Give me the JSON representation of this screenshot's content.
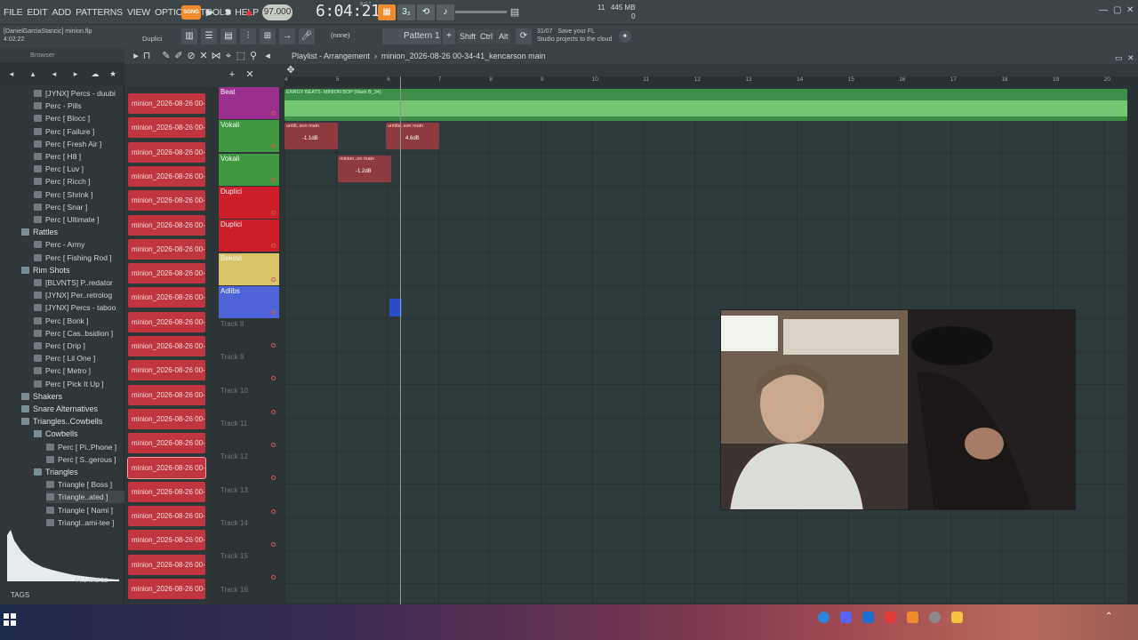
{
  "menu": [
    "FILE",
    "EDIT",
    "ADD",
    "PATTERNS",
    "VIEW",
    "OPTIONS",
    "TOOLS",
    "HELP"
  ],
  "transport": {
    "song_label": "SONG",
    "tempo": "97.000",
    "time": "6:04:21",
    "time_sub": "B:S:T"
  },
  "stats": {
    "voices": "11",
    "memory": "445 MB",
    "cpu": "0"
  },
  "project": {
    "user": "[DanielGarciaStancic]",
    "file": "minion.flp",
    "time": "4:02:22",
    "hint_channel": "Duplici"
  },
  "toolbar2": {
    "snap": "(none)",
    "pattern": "Pattern 1",
    "shift": "Shift",
    "ctrl": "Ctrl",
    "alt": "Alt",
    "hint_date": "31/07",
    "hint_line1": "Save your FL",
    "hint_line2": "Studio projects to the cloud"
  },
  "browser": {
    "title": "Browser",
    "items": [
      {
        "label": "[JYNX] Percs - duubi",
        "type": "file",
        "indent": 2
      },
      {
        "label": "Perc - Pills",
        "type": "file",
        "indent": 2
      },
      {
        "label": "Perc [ Blocc ]",
        "type": "file",
        "indent": 2
      },
      {
        "label": "Perc [ Failure ]",
        "type": "file",
        "indent": 2
      },
      {
        "label": "Perc [ Fresh Air ]",
        "type": "file",
        "indent": 2
      },
      {
        "label": "Perc [ H8 ]",
        "type": "file",
        "indent": 2
      },
      {
        "label": "Perc [ Luv ]",
        "type": "file",
        "indent": 2
      },
      {
        "label": "Perc [ Ricch ]",
        "type": "file",
        "indent": 2
      },
      {
        "label": "Perc [ Shrink ]",
        "type": "file",
        "indent": 2
      },
      {
        "label": "Perc [ Snar ]",
        "type": "file",
        "indent": 2
      },
      {
        "label": "Perc [ Ultimate ]",
        "type": "file",
        "indent": 2
      },
      {
        "label": "Rattles",
        "type": "folder",
        "indent": 1
      },
      {
        "label": "Perc - Army",
        "type": "file",
        "indent": 2
      },
      {
        "label": "Perc [ Fishing Rod ]",
        "type": "file",
        "indent": 2
      },
      {
        "label": "Rim Shots",
        "type": "folder",
        "indent": 1
      },
      {
        "label": "[BLVNTS] P..redator",
        "type": "file",
        "indent": 2
      },
      {
        "label": "[JYNX] Per..retrolog",
        "type": "file",
        "indent": 2
      },
      {
        "label": "[JYNX] Percs - taboo",
        "type": "file",
        "indent": 2
      },
      {
        "label": "Perc [ Bonk ]",
        "type": "file",
        "indent": 2
      },
      {
        "label": "Perc [ Cas..bsidion ]",
        "type": "file",
        "indent": 2
      },
      {
        "label": "Perc [ Drip ]",
        "type": "file",
        "indent": 2
      },
      {
        "label": "Perc [ Lil One ]",
        "type": "file",
        "indent": 2
      },
      {
        "label": "Perc [ Metro ]",
        "type": "file",
        "indent": 2
      },
      {
        "label": "Perc [ Pick It Up ]",
        "type": "file",
        "indent": 2
      },
      {
        "label": "Shakers",
        "type": "folder",
        "indent": 1
      },
      {
        "label": "Snare Alternatives",
        "type": "folder",
        "indent": 1
      },
      {
        "label": "Triangles..Cowbells",
        "type": "folder",
        "indent": 1
      },
      {
        "label": "Cowbells",
        "type": "folder",
        "indent": 2
      },
      {
        "label": "Perc [ Pi..Phone ]",
        "type": "file",
        "indent": 3
      },
      {
        "label": "Perc [ S..gerous ]",
        "type": "file",
        "indent": 3
      },
      {
        "label": "Triangles",
        "type": "folder",
        "indent": 2
      },
      {
        "label": "Triangle [ Boss ]",
        "type": "file",
        "indent": 3
      },
      {
        "label": "Triangle..ated ]",
        "type": "file",
        "indent": 3,
        "selected": true
      },
      {
        "label": "Triangle [ Nami ]",
        "type": "file",
        "indent": 3
      },
      {
        "label": "Triangl..ami-tee ]",
        "type": "file",
        "indent": 3
      }
    ],
    "sample_rate": "44.1 kHz 32",
    "tags": "TAGS"
  },
  "channels": {
    "label": "minion_2026-08-26 00-",
    "count": 21,
    "selected_index": 15
  },
  "playlist": {
    "title": "Playlist - Arrangement",
    "pattern_name": "minion_2026-08-26 00-34-41_kencarson main",
    "ruler": [
      "4",
      "5",
      "6",
      "7",
      "8",
      "9",
      "10",
      "11",
      "12",
      "13",
      "14",
      "15",
      "16",
      "17",
      "18",
      "19",
      "20"
    ],
    "tracks": [
      {
        "name": "Beat",
        "color": "#9a2f8f"
      },
      {
        "name": "Vokali",
        "color": "#3f9a3f"
      },
      {
        "name": "Vokali",
        "color": "#3f9a3f"
      },
      {
        "name": "Duplici",
        "color": "#cc1f2a"
      },
      {
        "name": "Duplici",
        "color": "#cc1f2a"
      },
      {
        "name": "Bekovi",
        "color": "#d9c46a"
      },
      {
        "name": "Adlibs",
        "color": "#4f63d8"
      },
      {
        "name": "Track 8",
        "color": ""
      },
      {
        "name": "Track 9",
        "color": ""
      },
      {
        "name": "Track 10",
        "color": ""
      },
      {
        "name": "Track 11",
        "color": ""
      },
      {
        "name": "Track 12",
        "color": ""
      },
      {
        "name": "Track 13",
        "color": ""
      },
      {
        "name": "Track 14",
        "color": ""
      },
      {
        "name": "Track 15",
        "color": ""
      },
      {
        "name": "Track 16",
        "color": ""
      }
    ],
    "clips": {
      "beat": "ENRGY BEATS- MINION BOP (Mark B_34)",
      "vok1a": "untitl..son main",
      "vok1a_gain": "-1.1dB",
      "vok1b": "untitle..son main",
      "vok1b_gain": "4.6dB",
      "vok2": "minion..on main",
      "vok2_gain": "-1.2dB"
    }
  }
}
